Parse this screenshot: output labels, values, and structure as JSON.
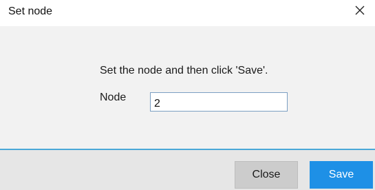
{
  "window": {
    "title": "Set node",
    "close_glyph": "close-icon"
  },
  "body": {
    "instruction": "Set the node and then click 'Save'.",
    "node_label": "Node",
    "node_value": "2"
  },
  "footer": {
    "close_label": "Close",
    "save_label": "Save"
  },
  "colors": {
    "accent": "#1e90e6",
    "divider": "#4aa8d8",
    "footer_bg": "#e6e6e6",
    "body_bg": "#f2f2f2",
    "close_button_bg": "#cccccc"
  }
}
